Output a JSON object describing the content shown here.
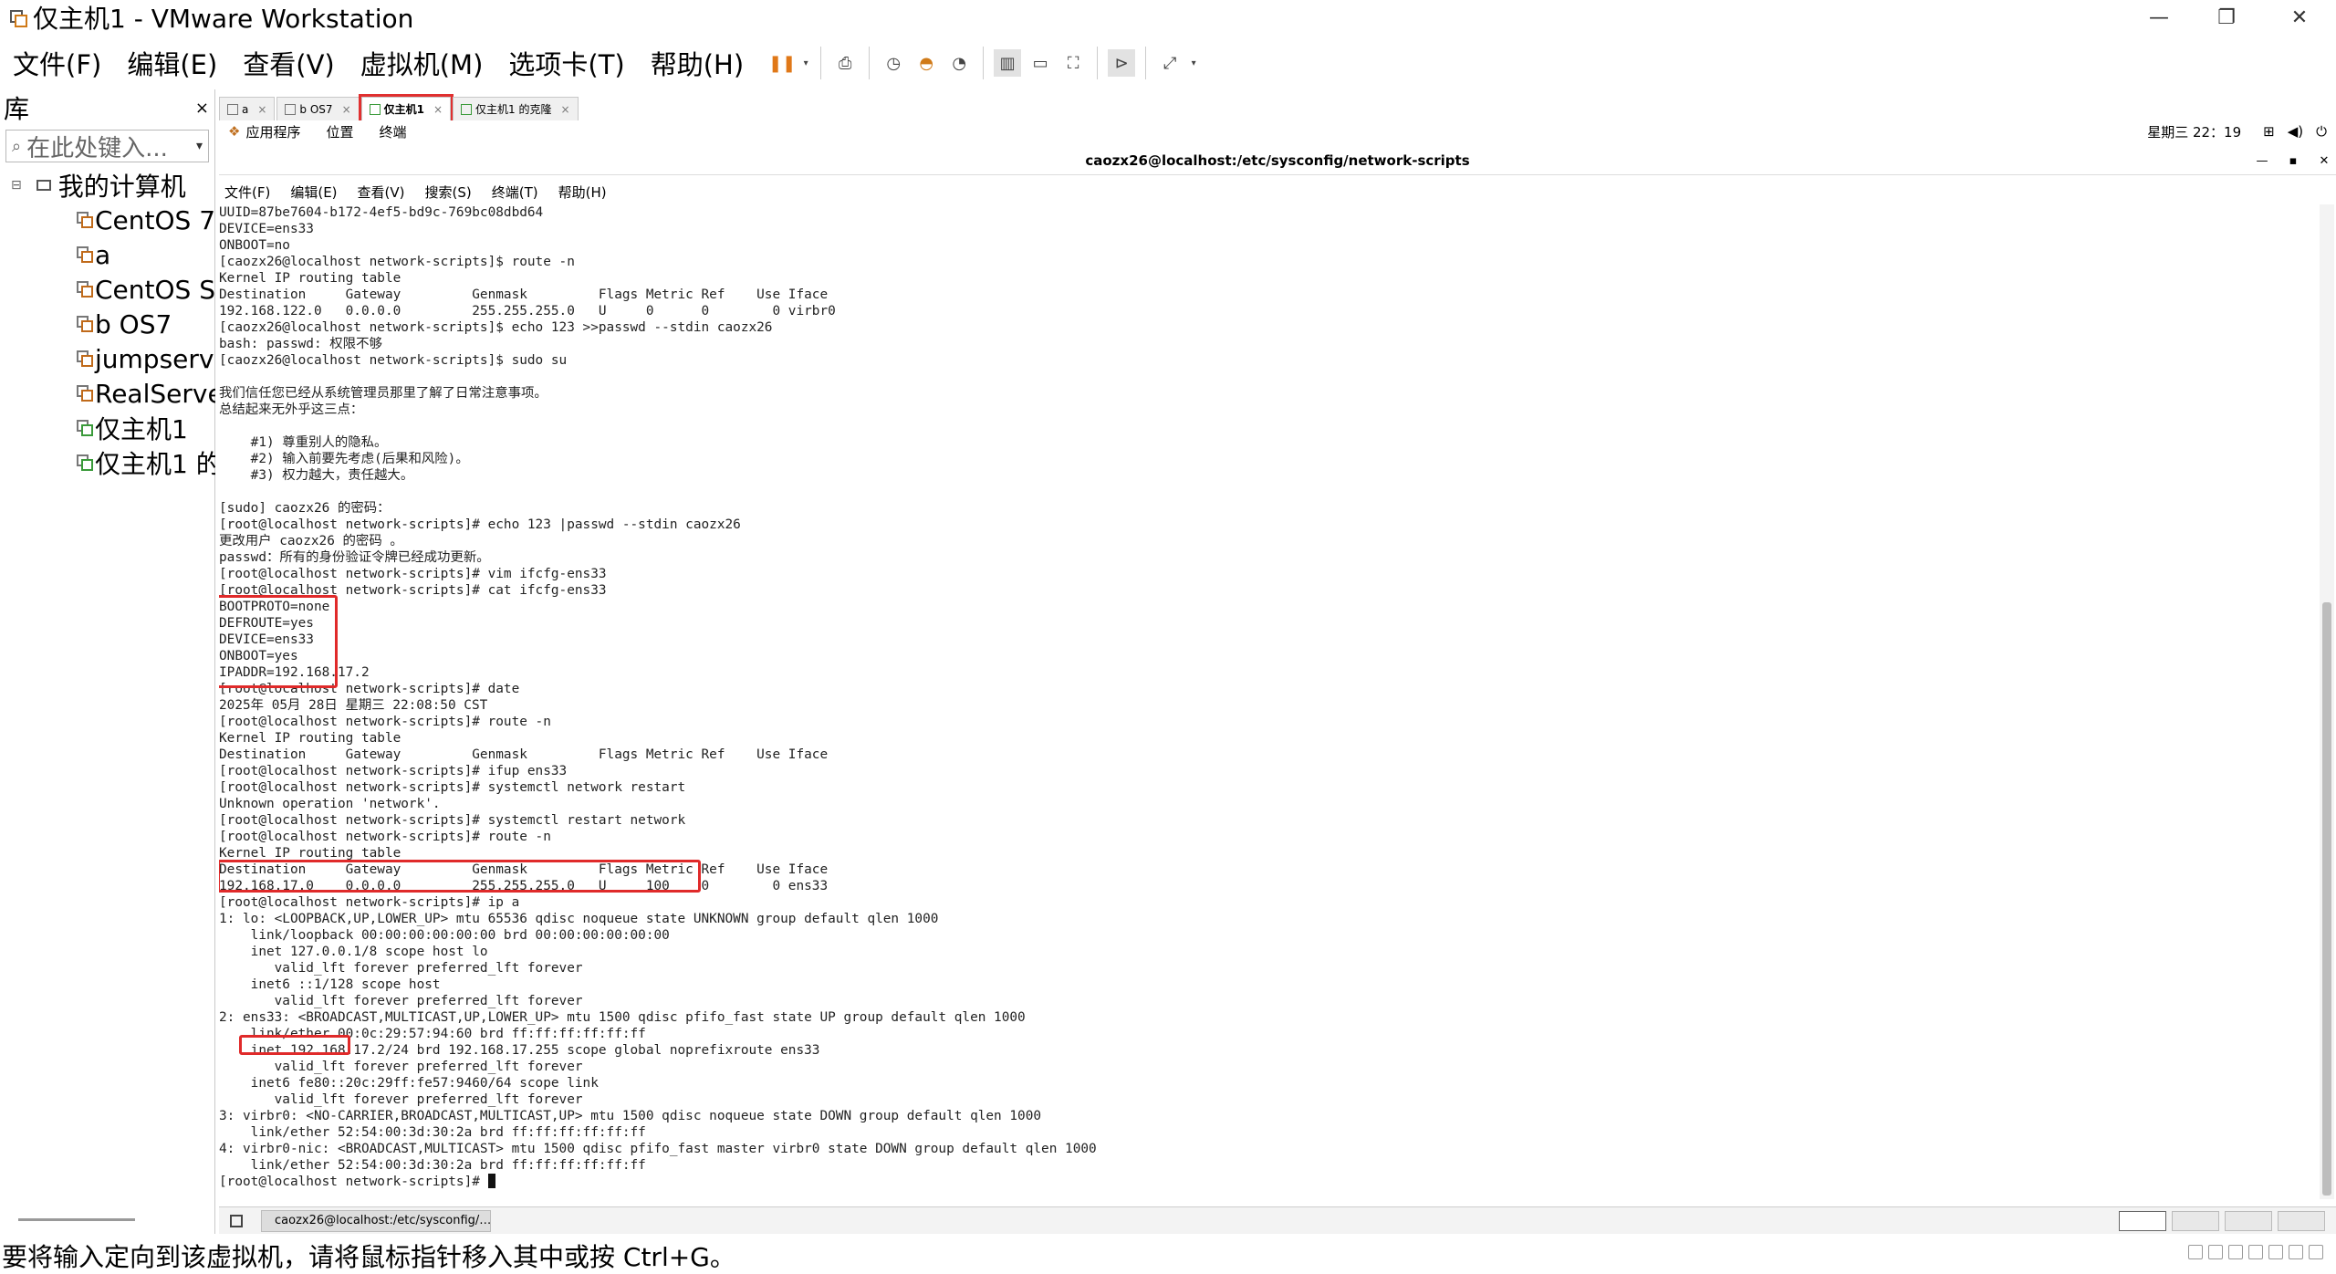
{
  "window": {
    "title": "仅主机1 - VMware Workstation",
    "minimize": "—",
    "restore": "❐",
    "close": "✕"
  },
  "menu": {
    "items": [
      "文件(F)",
      "编辑(E)",
      "查看(V)",
      "虚拟机(M)",
      "选项卡(T)",
      "帮助(H)"
    ]
  },
  "library": {
    "title": "库",
    "close": "×",
    "search_placeholder": "在此处键入...",
    "root_toggle": "⊟",
    "root_label": "我的计算机",
    "items": [
      "CentOS 7",
      "a",
      "CentOS St",
      "b OS7",
      "jumpserve",
      "RealServe",
      "仅主机1",
      "仅主机1 的"
    ]
  },
  "vm_tabs": [
    {
      "label": "a",
      "close": "×"
    },
    {
      "label": "b OS7",
      "close": "×"
    },
    {
      "label": "仅主机1",
      "close": "×"
    },
    {
      "label": "仅主机1 的克隆",
      "close": "×"
    }
  ],
  "guest_topbar": {
    "apps": "应用程序",
    "places": "位置",
    "terminal": "终端",
    "clock": "星期三 22：19"
  },
  "terminal": {
    "title": "caozx26@localhost:/etc/sysconfig/network-scripts",
    "menu": [
      "文件(F)",
      "编辑(E)",
      "查看(V)",
      "搜索(S)",
      "终端(T)",
      "帮助(H)"
    ],
    "lines": [
      "UUID=87be7604-b172-4ef5-bd9c-769bc08dbd64",
      "DEVICE=ens33",
      "ONBOOT=no",
      "[caozx26@localhost network-scripts]$ route -n",
      "Kernel IP routing table",
      "Destination     Gateway         Genmask         Flags Metric Ref    Use Iface",
      "192.168.122.0   0.0.0.0         255.255.255.0   U     0      0        0 virbr0",
      "[caozx26@localhost network-scripts]$ echo 123 >>passwd --stdin caozx26",
      "bash: passwd: 权限不够",
      "[caozx26@localhost network-scripts]$ sudo su",
      "",
      "我们信任您已经从系统管理员那里了解了日常注意事项。",
      "总结起来无外乎这三点：",
      "",
      "    #1) 尊重别人的隐私。",
      "    #2) 输入前要先考虑(后果和风险)。",
      "    #3) 权力越大，责任越大。",
      "",
      "[sudo] caozx26 的密码：",
      "[root@localhost network-scripts]# echo 123 |passwd --stdin caozx26",
      "更改用户 caozx26 的密码 。",
      "passwd：所有的身份验证令牌已经成功更新。",
      "[root@localhost network-scripts]# vim ifcfg-ens33",
      "[root@localhost network-scripts]# cat ifcfg-ens33",
      "BOOTPROTO=none",
      "DEFROUTE=yes",
      "DEVICE=ens33",
      "ONBOOT=yes",
      "IPADDR=192.168.17.2",
      "[root@localhost network-scripts]# date",
      "2025年 05月 28日 星期三 22:08:50 CST",
      "[root@localhost network-scripts]# route -n",
      "Kernel IP routing table",
      "Destination     Gateway         Genmask         Flags Metric Ref    Use Iface",
      "[root@localhost network-scripts]# ifup ens33",
      "[root@localhost network-scripts]# systemctl network restart",
      "Unknown operation 'network'.",
      "[root@localhost network-scripts]# systemctl restart network",
      "[root@localhost network-scripts]# route -n",
      "Kernel IP routing table",
      "Destination     Gateway         Genmask         Flags Metric Ref    Use Iface",
      "192.168.17.0    0.0.0.0         255.255.255.0   U     100    0        0 ens33",
      "[root@localhost network-scripts]# ip a",
      "1: lo: <LOOPBACK,UP,LOWER_UP> mtu 65536 qdisc noqueue state UNKNOWN group default qlen 1000",
      "    link/loopback 00:00:00:00:00:00 brd 00:00:00:00:00:00",
      "    inet 127.0.0.1/8 scope host lo",
      "       valid_lft forever preferred_lft forever",
      "    inet6 ::1/128 scope host",
      "       valid_lft forever preferred_lft forever",
      "2: ens33: <BROADCAST,MULTICAST,UP,LOWER_UP> mtu 1500 qdisc pfifo_fast state UP group default qlen 1000",
      "    link/ether 00:0c:29:57:94:60 brd ff:ff:ff:ff:ff:ff",
      "    inet 192.168.17.2/24 brd 192.168.17.255 scope global noprefixroute ens33",
      "       valid_lft forever preferred_lft forever",
      "    inet6 fe80::20c:29ff:fe57:9460/64 scope link",
      "       valid_lft forever preferred_lft forever",
      "3: virbr0: <NO-CARRIER,BROADCAST,MULTICAST,UP> mtu 1500 qdisc noqueue state DOWN group default qlen 1000",
      "    link/ether 52:54:00:3d:30:2a brd ff:ff:ff:ff:ff:ff",
      "4: virbr0-nic: <BROADCAST,MULTICAST> mtu 1500 qdisc pfifo_fast master virbr0 state DOWN group default qlen 1000",
      "    link/ether 52:54:00:3d:30:2a brd ff:ff:ff:ff:ff:ff",
      "[root@localhost network-scripts]# "
    ]
  },
  "guest_taskbar": {
    "task_label": "caozx26@localhost:/etc/sysconfig/…"
  },
  "statusbar": {
    "text": "要将输入定向到该虚拟机，请将鼠标指针移入其中或按 Ctrl+G。"
  },
  "colors": {
    "highlight": "#e02a2a",
    "pause_orange": "#e07818"
  }
}
